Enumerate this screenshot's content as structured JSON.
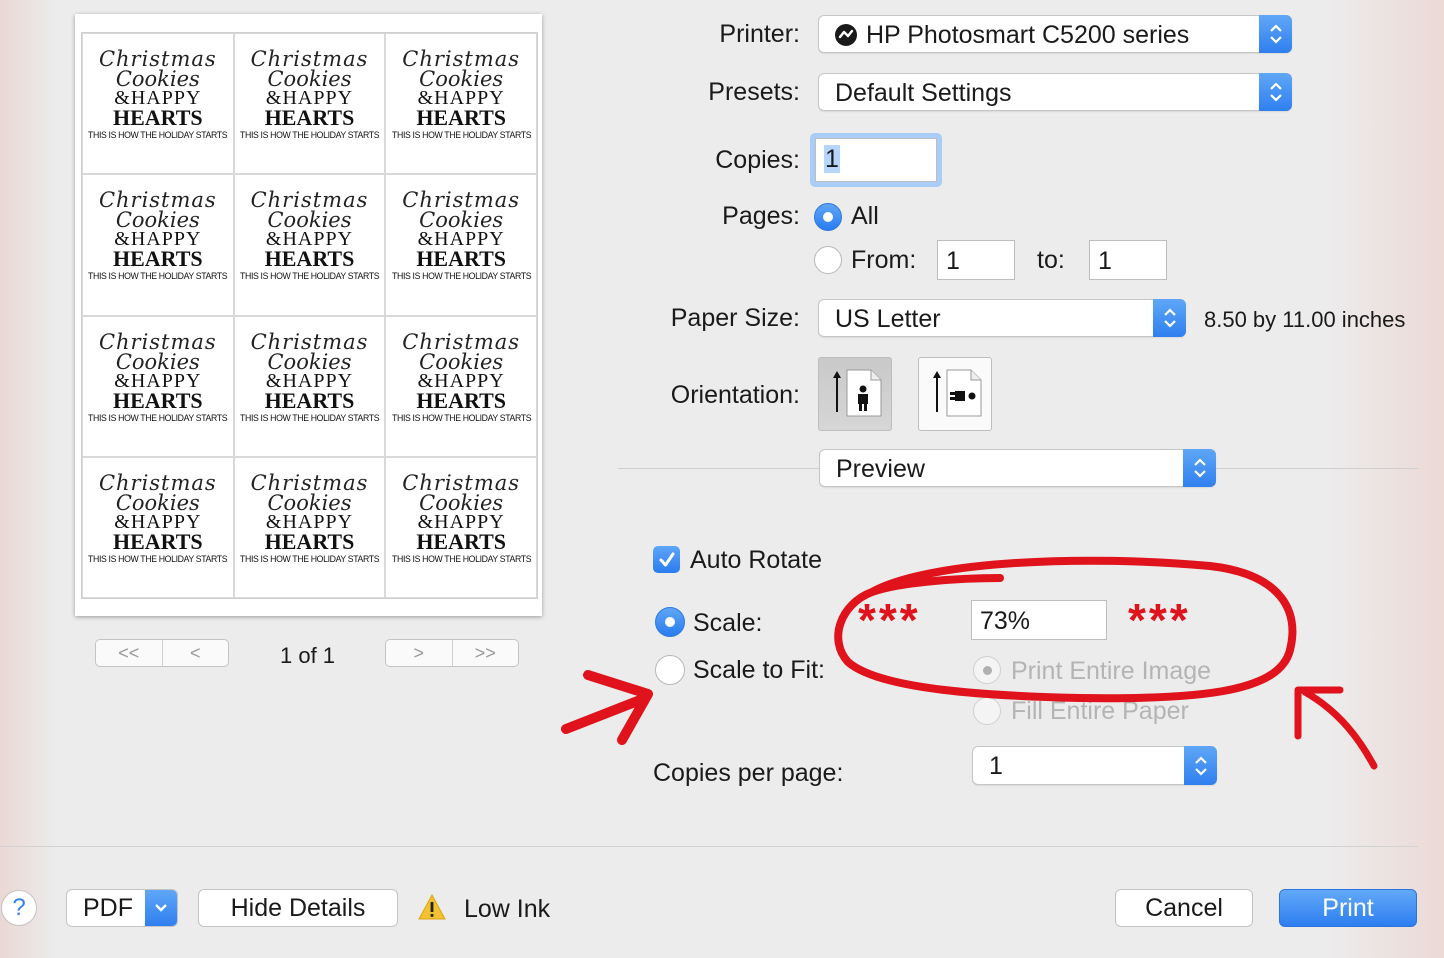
{
  "preview": {
    "label_lines": {
      "script1": "Christmas",
      "script2": "Cookies",
      "amp": "&",
      "happy": "HAPPY",
      "hearts": "HEARTS",
      "tagline": "THIS IS HOW THE HOLIDAY STARTS"
    },
    "label_count": 12,
    "nav": {
      "first": "<<",
      "prev": "<",
      "next": ">",
      "last": ">>"
    },
    "page_indicator": "1 of 1"
  },
  "printer": {
    "label": "Printer:",
    "value": "HP Photosmart C5200 series"
  },
  "presets": {
    "label": "Presets:",
    "value": "Default Settings"
  },
  "copies": {
    "label": "Copies:",
    "value": "1"
  },
  "pages": {
    "label": "Pages:",
    "all_label": "All",
    "from_label": "From:",
    "from_value": "1",
    "to_label": "to:",
    "to_value": "1"
  },
  "paper_size": {
    "label": "Paper Size:",
    "value": "US Letter",
    "dimensions": "8.50 by 11.00 inches"
  },
  "orientation": {
    "label": "Orientation:",
    "selected": "portrait"
  },
  "section_popup": {
    "value": "Preview"
  },
  "auto_rotate": {
    "label": "Auto Rotate",
    "checked": true
  },
  "scale": {
    "label": "Scale:",
    "value": "73%",
    "selected": true
  },
  "scale_to_fit": {
    "label": "Scale to Fit:",
    "option1": "Print Entire Image",
    "option2": "Fill Entire Paper",
    "selected": false
  },
  "copies_per_page": {
    "label": "Copies per page:",
    "value": "1"
  },
  "annotations": {
    "stars_left": "***",
    "stars_right": "***",
    "color": "#e0121b"
  },
  "footer": {
    "help": "?",
    "pdf": "PDF",
    "hide_details": "Hide Details",
    "low_ink": "Low Ink",
    "cancel": "Cancel",
    "print": "Print"
  },
  "colors": {
    "accent": "#3183f1",
    "annotation_red": "#e0121b"
  }
}
